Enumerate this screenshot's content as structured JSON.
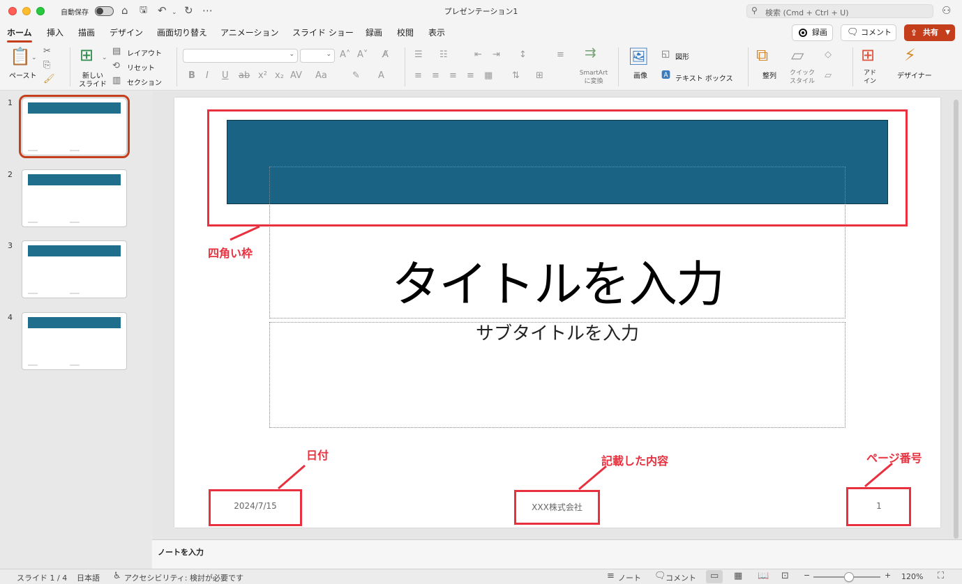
{
  "titlebar": {
    "autosave_label": "自動保存",
    "doc_title": "プレゼンテーション1",
    "search_placeholder": "検索 (Cmd + Ctrl + U)"
  },
  "tabs": [
    "ホーム",
    "挿入",
    "描画",
    "デザイン",
    "画面切り替え",
    "アニメーション",
    "スライド ショー",
    "録画",
    "校閲",
    "表示"
  ],
  "ribbon_buttons": {
    "record": "録画",
    "comment": "コメント",
    "share": "共有"
  },
  "ribbon": {
    "paste": "ペースト",
    "new_slide_line1": "新しい",
    "new_slide_line2": "スライド",
    "layout": "レイアウト",
    "reset": "リセット",
    "section": "セクション",
    "smartart_line1": "SmartArt",
    "smartart_line2": "に変換",
    "picture": "画像",
    "shapes": "図形",
    "textbox": "テキスト ボックス",
    "arrange": "整列",
    "quick_styles_line1": "クイック",
    "quick_styles_line2": "スタイル",
    "addins_line1": "アド",
    "addins_line2": "イン",
    "designer": "デザイナー"
  },
  "thumbnails": [
    {
      "number": "1"
    },
    {
      "number": "2"
    },
    {
      "number": "3"
    },
    {
      "number": "4"
    }
  ],
  "slide": {
    "title": "タイトルを入力",
    "subtitle": "サブタイトルを入力",
    "footer_date": "2024/7/15",
    "footer_text": "XXX株式会社",
    "footer_page": "1"
  },
  "annotations": {
    "rect_label": "四角い枠",
    "date_label": "日付",
    "footer_label": "記載した内容",
    "page_label": "ページ番号",
    "color": "#e8303e"
  },
  "notes_placeholder": "ノートを入力",
  "statusbar": {
    "slide_indicator": "スライド 1 / 4",
    "language": "日本語",
    "accessibility": "アクセシビリティ: 検討が必要です",
    "notes": "ノート",
    "comments": "コメント",
    "zoom": "120%"
  },
  "colors": {
    "accent": "#c43e1c",
    "slide_rect": "#1a6384"
  }
}
